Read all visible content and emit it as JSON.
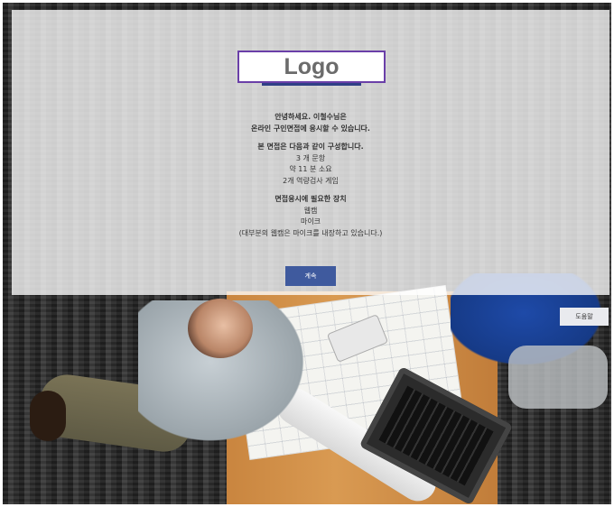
{
  "logo": {
    "text": "Logo",
    "border_color": "#6a3fa8"
  },
  "intro": {
    "greeting": "안녕하세요. 이철수님은",
    "line2": "온라인 구인면접에 응시할 수 있습니다."
  },
  "composition": {
    "heading": "본 면접은 다음과 같이 구성합니다.",
    "items": [
      "3 개 문항",
      "약 11 분 소요",
      "2개 역량검사 게임"
    ]
  },
  "devices": {
    "heading": "면접응시에 필요한 장치",
    "items": [
      "웹캠",
      "마이크"
    ],
    "note": "(대부분의 웹캠은 마이크를 내장하고 있습니다.)"
  },
  "buttons": {
    "continue_label": "계속",
    "help_label": "도움말"
  },
  "colors": {
    "primary_button": "#3f5a9e",
    "overlay": "rgba(255,255,255,0.78)"
  }
}
